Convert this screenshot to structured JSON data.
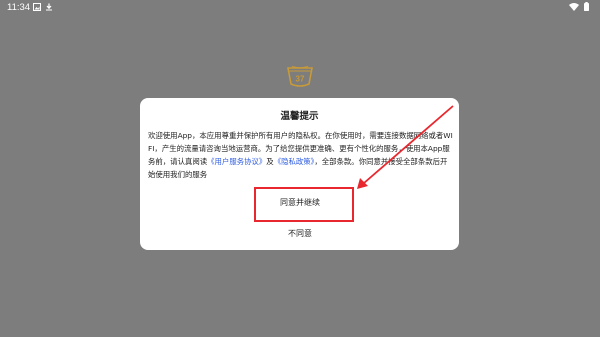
{
  "status_bar": {
    "time": "11:34",
    "left_icons": [
      "image-notification-icon",
      "download-notification-icon"
    ],
    "right_icons": [
      "wifi-icon",
      "battery-icon"
    ]
  },
  "app_logo": {
    "text": "37",
    "icon": "bowl-logo-icon",
    "color": "#c79a3a"
  },
  "dialog": {
    "title": "温馨提示",
    "body_part1": "欢迎使用App，本应用尊重并保护所有用户的隐私权。在你使用时，需要连接数据网络或者WIFI，产生的流量请咨询当地运营商。为了给您提供更准确、更有个性化的服务，使用本App服务前，请认真阅读",
    "link_user_agreement": "《用户服务协议》",
    "and_text": "及",
    "link_privacy_policy": "《隐私政策》",
    "body_part2": "，全部条款。你同意并接受全部条款后开始使用我们的服务",
    "agree_button": "同意并继续",
    "disagree_button": "不同意",
    "link_color": "#2f5de0"
  },
  "annotation": {
    "highlight_color": "#e8282e",
    "arrow_color": "#e8282e"
  }
}
